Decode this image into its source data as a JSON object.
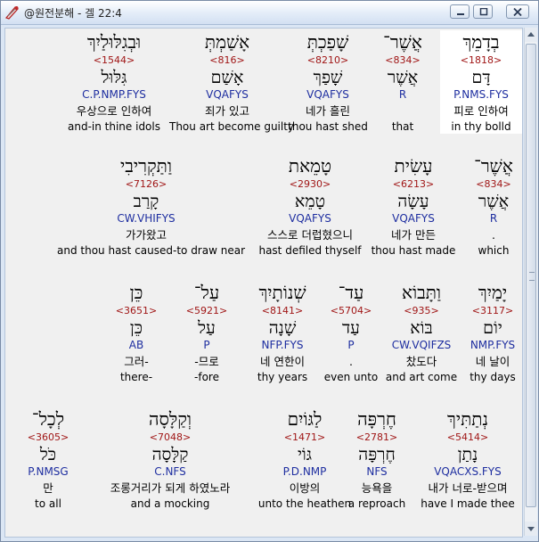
{
  "window": {
    "title": "@원전분해 - 겔 22:4"
  },
  "rows": [
    [
      {
        "heb": "בְדָמֵךְ",
        "strong": "<1818>",
        "root": "דָּם",
        "morph": "P.NMS.FYS",
        "kor": "피로 인하여",
        "eng": "in thy bolld"
      },
      {
        "heb": "אֲשֶׁר־",
        "strong": "<834>",
        "root": "אֲשֶׁר",
        "morph": "R",
        "kor": "",
        "eng": "that"
      },
      {
        "heb": "שָׁפַכְתְּ",
        "strong": "<8210>",
        "root": "שָׁפַךְ",
        "morph": "VQAFYS",
        "kor": "네가 흘린",
        "eng": "thou hast shed"
      },
      {
        "heb": "אָשַׁמְתְּ",
        "strong": "<816>",
        "root": "אָשַׁם",
        "morph": "VQAFYS",
        "kor": "죄가 있고",
        "eng": "Thou art become guilty"
      },
      {
        "heb": "וּבְגִלּוּלַיִךְ",
        "strong": "<1544>",
        "root": "גִּלּוּל",
        "morph": "C.P.NMP.FYS",
        "kor": "우상으로 인하여",
        "eng": "and-in thine idols"
      }
    ],
    [
      {
        "heb": "אֲשֶׁר־",
        "strong": "<834>",
        "root": "אֲשֶׁר",
        "morph": "R",
        "kor": ".",
        "eng": "which"
      },
      {
        "heb": "עָשִׂית",
        "strong": "<6213>",
        "root": "עָשָׂה",
        "morph": "VQAFYS",
        "kor": "네가 만든",
        "eng": "thou hast made"
      },
      {
        "heb": "טָמֵאת",
        "strong": "<2930>",
        "root": "טָמֵא",
        "morph": "VQAFYS",
        "kor": "스스로 더럽혔으니",
        "eng": "hast defiled thyself"
      },
      {
        "heb": "וַתַּקְרִיבִי",
        "strong": "<7126>",
        "root": "קָרַב",
        "morph": "CW.VHIFYS",
        "kor": "가가왔고",
        "eng": "and thou hast caused-to draw near"
      }
    ],
    [
      {
        "heb": "יָמַיִךְ",
        "strong": "<3117>",
        "root": "יוֹם",
        "morph": "NMP.FYS",
        "kor": "네 날이",
        "eng": "thy days"
      },
      {
        "heb": "וַתָּבוֹא",
        "strong": "<935>",
        "root": "בּוֹא",
        "morph": "CW.VQIFZS",
        "kor": "찼도다",
        "eng": "and art come"
      },
      {
        "heb": "עַד־",
        "strong": "<5704>",
        "root": "עַד",
        "morph": "P",
        "kor": ".",
        "eng": "even unto"
      },
      {
        "heb": "שְׁנוֹתָיִךְ",
        "strong": "<8141>",
        "root": "שָׁנָה",
        "morph": "NFP.FYS",
        "kor": "네 연한이",
        "eng": "thy years"
      },
      {
        "heb": "עַל־",
        "strong": "<5921>",
        "root": "עַל",
        "morph": "P",
        "kor": "-므로",
        "eng": "-fore"
      },
      {
        "heb": "כֵּן",
        "strong": "<3651>",
        "root": "כֵּן",
        "morph": "AB",
        "kor": "그러-",
        "eng": "there-"
      }
    ],
    [
      {
        "heb": "נְתַתִּיךְ",
        "strong": "<5414>",
        "root": "נָתַן",
        "morph": "VQACXS.FYS",
        "kor": "내가 너로-받으며",
        "eng": "have I made thee"
      },
      {
        "heb": "חֶרְפָּה",
        "strong": "<2781>",
        "root": "חֶרְפָּה",
        "morph": "NFS",
        "kor": "능욕을",
        "eng": "a reproach"
      },
      {
        "heb": "לַגּוֹיִם",
        "strong": "<1471>",
        "root": "גּוֹי",
        "morph": "P.D.NMP",
        "kor": "이방의",
        "eng": "unto the heathen"
      },
      {
        "heb": "וְקַלָּסָה",
        "strong": "<7048>",
        "root": "קַלָּסָה",
        "morph": "C.NFS",
        "kor": "조롱거리가 되게 하였노라",
        "eng": "and a mocking"
      },
      {
        "heb": "לְכָל־",
        "strong": "<3605>",
        "root": "כֹּל",
        "morph": "P.NMSG",
        "kor": "만",
        "eng": "to all"
      }
    ]
  ]
}
